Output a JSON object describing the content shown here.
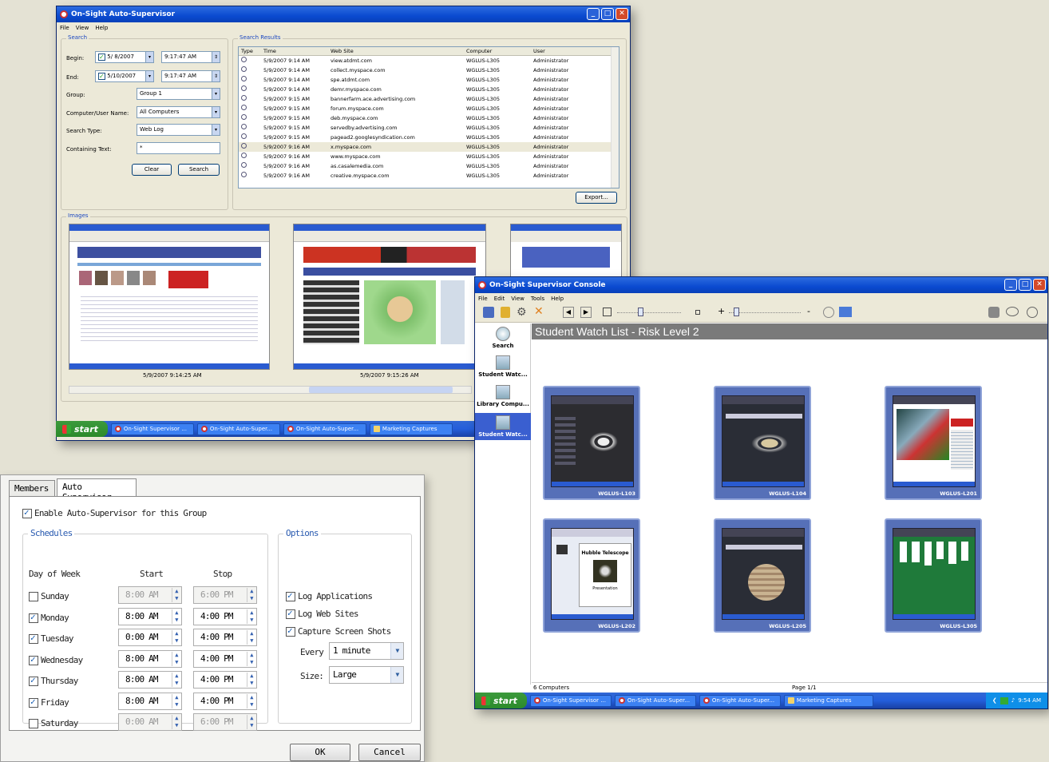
{
  "auto": {
    "title": "On-Sight Auto-Supervisor",
    "menu": [
      "File",
      "View",
      "Help"
    ],
    "search_group": "Search",
    "begin_label": "Begin:",
    "begin_date": "5/ 8/2007",
    "begin_time": "9:17:47 AM",
    "end_label": "End:",
    "end_date": "5/10/2007",
    "end_time": "9:17:47 AM",
    "group_label": "Group:",
    "group_value": "Group 1",
    "computer_label": "Computer/User Name:",
    "computer_value": "All Computers",
    "type_label": "Search Type:",
    "type_value": "Web Log",
    "text_label": "Containing Text:",
    "text_value": "*",
    "clear": "Clear",
    "search": "Search",
    "results_group": "Search Results",
    "columns": [
      "Type",
      "Time",
      "Web Site",
      "Computer",
      "User"
    ],
    "rows": [
      [
        "5/9/2007 9:14 AM",
        "view.atdmt.com",
        "WGLUS-L305",
        "Administrator"
      ],
      [
        "5/9/2007 9:14 AM",
        "collect.myspace.com",
        "WGLUS-L305",
        "Administrator"
      ],
      [
        "5/9/2007 9:14 AM",
        "spe.atdmt.com",
        "WGLUS-L305",
        "Administrator"
      ],
      [
        "5/9/2007 9:14 AM",
        "demr.myspace.com",
        "WGLUS-L305",
        "Administrator"
      ],
      [
        "5/9/2007 9:15 AM",
        "bannerfarm.ace.advertising.com",
        "WGLUS-L305",
        "Administrator"
      ],
      [
        "5/9/2007 9:15 AM",
        "forum.myspace.com",
        "WGLUS-L305",
        "Administrator"
      ],
      [
        "5/9/2007 9:15 AM",
        "deb.myspace.com",
        "WGLUS-L305",
        "Administrator"
      ],
      [
        "5/9/2007 9:15 AM",
        "servedby.advertising.com",
        "WGLUS-L305",
        "Administrator"
      ],
      [
        "5/9/2007 9:15 AM",
        "pagead2.googlesyndication.com",
        "WGLUS-L305",
        "Administrator"
      ],
      [
        "5/9/2007 9:16 AM",
        "x.myspace.com",
        "WGLUS-L305",
        "Administrator"
      ],
      [
        "5/9/2007 9:16 AM",
        "www.myspace.com",
        "WGLUS-L305",
        "Administrator"
      ],
      [
        "5/9/2007 9:16 AM",
        "as.casalemedia.com",
        "WGLUS-L305",
        "Administrator"
      ],
      [
        "5/9/2007 9:16 AM",
        "creative.myspace.com",
        "WGLUS-L305",
        "Administrator"
      ]
    ],
    "export": "Export...",
    "images_group": "Images",
    "image_captions": [
      "5/9/2007 9:14:25 AM",
      "5/9/2007 9:15:26 AM"
    ]
  },
  "taskbar1": {
    "start": "start",
    "items": [
      "On-Sight Supervisor ...",
      "On-Sight Auto-Super...",
      "On-Sight Auto-Super...",
      "Marketing Captures"
    ]
  },
  "console": {
    "title": "On-Sight Supervisor Console",
    "menu": [
      "File",
      "Edit",
      "View",
      "Tools",
      "Help"
    ],
    "header": "Student Watch List - Risk Level 2",
    "side": [
      "Search",
      "Student Watc...",
      "Library Compu...",
      "Student Watc..."
    ],
    "cards": [
      "WGLUS-L103",
      "WGLUS-L104",
      "WGLUS-L201",
      "WGLUS-L202",
      "WGLUS-L205",
      "WGLUS-L305"
    ],
    "slide_title": "Hubble Telescope",
    "slide_sub": "Presentation",
    "status_left": "6 Computers",
    "status_page": "Page 1/1",
    "clock": "9:54 AM",
    "taskbar": [
      "On-Sight Supervisor ...",
      "On-Sight Auto-Super...",
      "On-Sight Auto-Super...",
      "Marketing Captures"
    ]
  },
  "dialog": {
    "tabs": [
      "Members",
      "Auto Supervisor"
    ],
    "enable": "Enable Auto-Supervisor for this Group",
    "schedules": "Schedules",
    "col_day": "Day of Week",
    "col_start": "Start",
    "col_stop": "Stop",
    "days": [
      {
        "name": "Sunday",
        "checked": false,
        "start": "8:00 AM",
        "stop": "6:00 PM"
      },
      {
        "name": "Monday",
        "checked": true,
        "start": "8:00 AM",
        "stop": "4:00 PM"
      },
      {
        "name": "Tuesday",
        "checked": true,
        "start": "0:00 AM",
        "stop": "4:00 PM"
      },
      {
        "name": "Wednesday",
        "checked": true,
        "start": "8:00 AM",
        "stop": "4:00 PM"
      },
      {
        "name": "Thursday",
        "checked": true,
        "start": "8:00 AM",
        "stop": "4:00 PM"
      },
      {
        "name": "Friday",
        "checked": true,
        "start": "8:00 AM",
        "stop": "4:00 PM"
      },
      {
        "name": "Saturday",
        "checked": false,
        "start": "0:00 AM",
        "stop": "6:00 PM"
      }
    ],
    "options": "Options",
    "log_apps": "Log Applications",
    "log_web": "Log Web Sites",
    "capture": "Capture Screen Shots",
    "every_label": "Every",
    "every_value": "1 minute",
    "size_label": "Size:",
    "size_value": "Large",
    "ok": "OK",
    "cancel": "Cancel"
  }
}
